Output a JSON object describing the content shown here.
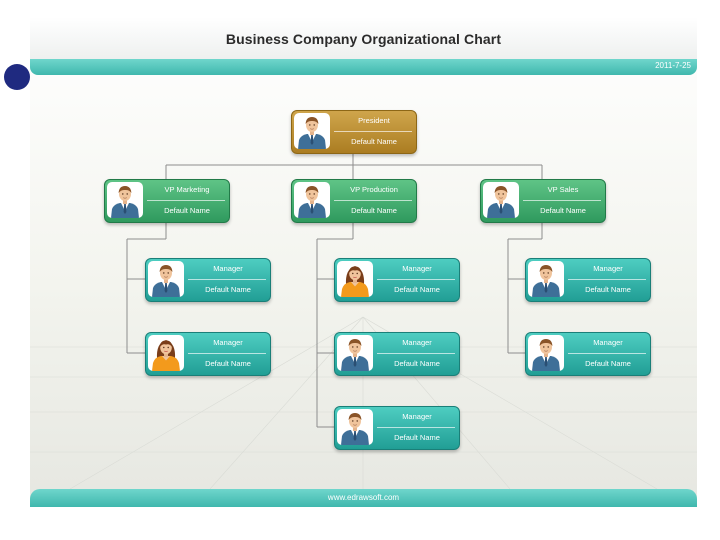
{
  "chart": {
    "title": "Business Company Organizational Chart",
    "date": "2011-7-25",
    "footer_url": "www.edrawsoft.com"
  },
  "colors": {
    "band": "#3fb7ad",
    "president_box": "#ab7d22",
    "vp_box": "#2f9a5e",
    "manager_box": "#219e95",
    "bullet": "#1f2a80",
    "connector": "#8d8d8d"
  },
  "org": {
    "president": {
      "role": "President",
      "name": "Default Name",
      "avatar": "male-avatar-icon"
    },
    "vp_marketing": {
      "role": "VP Marketing",
      "name": "Default Name",
      "avatar": "male-avatar-icon"
    },
    "vp_production": {
      "role": "VP Production",
      "name": "Default Name",
      "avatar": "male-avatar-icon"
    },
    "vp_sales": {
      "role": "VP Sales",
      "name": "Default Name",
      "avatar": "male-avatar-icon"
    },
    "marketing_managers": [
      {
        "role": "Manager",
        "name": "Default Name",
        "avatar": "male-avatar-icon"
      },
      {
        "role": "Manager",
        "name": "Default Name",
        "avatar": "female-avatar-icon"
      }
    ],
    "production_managers": [
      {
        "role": "Manager",
        "name": "Default Name",
        "avatar": "female-avatar-icon"
      },
      {
        "role": "Manager",
        "name": "Default Name",
        "avatar": "male-avatar-icon"
      },
      {
        "role": "Manager",
        "name": "Default Name",
        "avatar": "male-avatar-icon"
      }
    ],
    "sales_managers": [
      {
        "role": "Manager",
        "name": "Default Name",
        "avatar": "male-avatar-icon"
      },
      {
        "role": "Manager",
        "name": "Default Name",
        "avatar": "male-avatar-icon"
      }
    ]
  }
}
